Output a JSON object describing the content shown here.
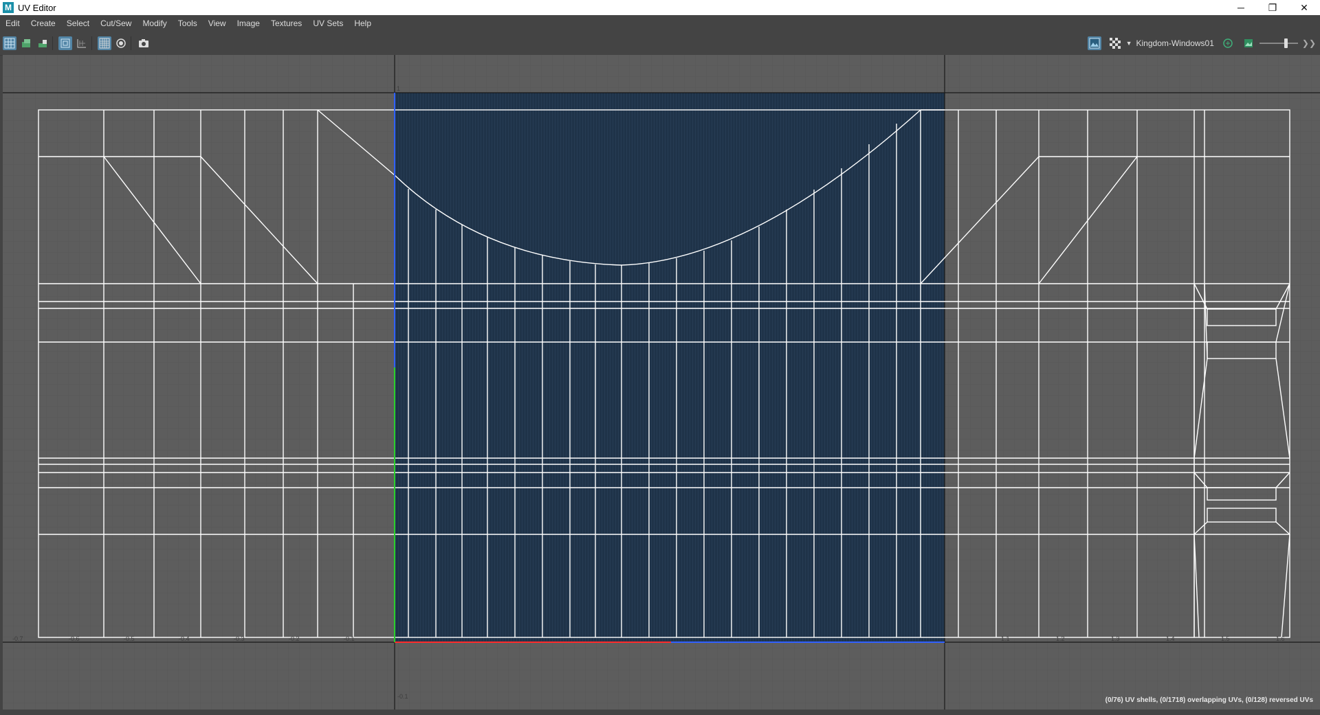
{
  "window": {
    "title": "UV Editor",
    "app_icon": "maya-icon",
    "controls": {
      "minimize": "─",
      "restore": "❐",
      "close": "✕"
    }
  },
  "menu": [
    "Edit",
    "Create",
    "Select",
    "Cut/Sew",
    "Modify",
    "Tools",
    "View",
    "Image",
    "Textures",
    "UV Sets",
    "Help"
  ],
  "toolbar": {
    "left_icons": [
      "uv-grid-icon",
      "uv-shell-icon",
      "uv-face-icon",
      "uv-frame-icon",
      "uv-distort-icon",
      "grid-toggle-icon",
      "snapshot-sphere-icon",
      "camera-snapshot-icon"
    ],
    "texture_name": "Kingdom-Windows01",
    "right_icons": [
      "image-display-icon",
      "checker-icon",
      "dropdown-arrow-icon",
      "texture-link-icon",
      "image-icon",
      "exposure-slider-icon",
      "more-icon"
    ]
  },
  "viewport": {
    "u_axis_labels": [
      "-0.7",
      "-0.6",
      "-0.5",
      "-0.4",
      "-0.3",
      "-0.2",
      "-0.1",
      "1.1",
      "1.2",
      "1.3",
      "1.4",
      "1.5",
      "1.6"
    ],
    "v_axis_labels": [
      "1",
      "-0.1"
    ],
    "colors": {
      "background": "#5d5d5d",
      "uv_tile": "#1f3349",
      "wire": "#ffffff",
      "u_axis": "#ff2a2a",
      "v_axis": "#2ad02a"
    }
  },
  "status_bar": {
    "text": "(0/76) UV shells, (0/1718) overlapping UVs, (0/128) reversed UVs"
  }
}
